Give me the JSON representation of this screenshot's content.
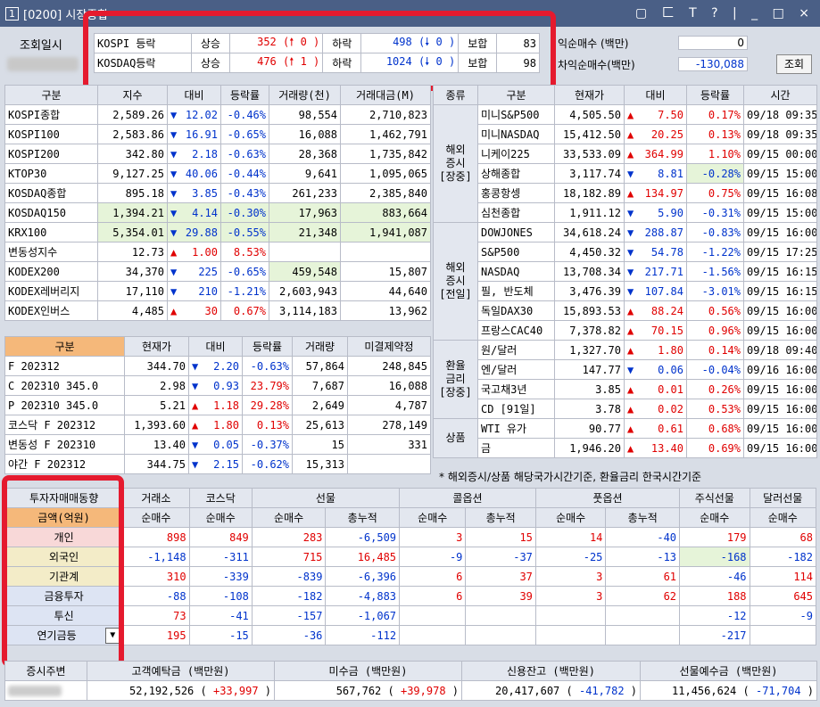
{
  "window": {
    "number": "1",
    "title": "[0200] 시장종합",
    "controls": "▢ 匚 T ? | _ □ ×"
  },
  "top": {
    "date_label": "조회일시",
    "kospi": {
      "label": "KOSPI 등락",
      "up_label": "상승",
      "up": "352 (🠕",
      "up_limit": "0 )",
      "down_label": "하락",
      "down": "498 (🠗",
      "down_limit": "0 )",
      "flat_label": "보합",
      "flat": "83"
    },
    "kosdaq": {
      "label": "KOSDAQ등락",
      "up_label": "상승",
      "up": "476 (🠕",
      "up_limit": "1 )",
      "down_label": "하락",
      "down": "1024 (🠗",
      "down_limit": "0 )",
      "flat_label": "보합",
      "flat": "98"
    },
    "arb_label": "익순매수 (백만)",
    "arb_value": "0",
    "nonarb_label": "차익순매수(백만)",
    "nonarb_value": "-130,088",
    "query_button": "조회"
  },
  "index_table": {
    "headers": [
      "구분",
      "지수",
      "대비",
      "등락률",
      "거래량(천)",
      "거래대금(M)"
    ],
    "rows": [
      [
        "KOSPI종합",
        "2,589.26",
        "▼",
        "12.02",
        "-0.46%",
        "98,554",
        "2,710,823"
      ],
      [
        "KOSPI100",
        "2,583.86",
        "▼",
        "16.91",
        "-0.65%",
        "16,088",
        "1,462,791"
      ],
      [
        "KOSPI200",
        "342.80",
        "▼",
        "2.18",
        "-0.63%",
        "28,368",
        "1,735,842"
      ],
      [
        "KTOP30",
        "9,127.25",
        "▼",
        "40.06",
        "-0.44%",
        "9,641",
        "1,095,065"
      ],
      [
        "KOSDAQ종합",
        "895.18",
        "▼",
        "3.85",
        "-0.43%",
        "261,233",
        "2,385,840"
      ],
      [
        "KOSDAQ150",
        "1,394.21",
        "▼",
        "4.14",
        "-0.30%",
        "17,963",
        "883,664"
      ],
      [
        "KRX100",
        "5,354.01",
        "▼",
        "29.88",
        "-0.55%",
        "21,348",
        "1,941,087"
      ],
      [
        "변동성지수",
        "12.73",
        "▲",
        "1.00",
        "8.53%",
        "",
        ""
      ],
      [
        "KODEX200",
        "34,370",
        "▼",
        "225",
        "-0.65%",
        "459,548",
        "15,807"
      ],
      [
        "KODEX레버리지",
        "17,110",
        "▼",
        "210",
        "-1.21%",
        "2,603,943",
        "44,640"
      ],
      [
        "KODEX인버스",
        "4,485",
        "▲",
        "30",
        "0.67%",
        "3,114,183",
        "13,962"
      ]
    ]
  },
  "futures_table": {
    "headers": [
      "구분",
      "현재가",
      "대비",
      "등락률",
      "거래량",
      "미결제약정"
    ],
    "rows": [
      [
        "F 202312",
        "344.70",
        "▼",
        "2.20",
        "-0.63%",
        "57,864",
        "248,845"
      ],
      [
        "C 202310 345.0",
        "2.98",
        "▼",
        "0.93",
        "23.79%",
        "7,687",
        "16,088"
      ],
      [
        "P 202310 345.0",
        "5.21",
        "▲",
        "1.18",
        "29.28%",
        "2,649",
        "4,787"
      ],
      [
        "코스닥 F 202312",
        "1,393.60",
        "▲",
        "1.80",
        "0.13%",
        "25,613",
        "278,149"
      ],
      [
        "변동성 F 202310",
        "13.40",
        "▼",
        "0.05",
        "-0.37%",
        "15",
        "331"
      ],
      [
        "야간 F 202312",
        "344.75",
        "▼",
        "2.15",
        "-0.62%",
        "15,313",
        ""
      ]
    ]
  },
  "world_table": {
    "headers": [
      "종류",
      "구분",
      "현재가",
      "대비",
      "등락률",
      "시간"
    ],
    "groups": [
      {
        "label": "해외\n증시\n[장중]",
        "rows": [
          [
            "미니S&P500",
            "4,505.50",
            "▲",
            "7.50",
            "0.17%",
            "09/18 09:35"
          ],
          [
            "미니NASDAQ",
            "15,412.50",
            "▲",
            "20.25",
            "0.13%",
            "09/18 09:35"
          ],
          [
            "니케이225",
            "33,533.09",
            "▲",
            "364.99",
            "1.10%",
            "09/15 00:00"
          ],
          [
            "상해종합",
            "3,117.74",
            "▼",
            "8.81",
            "-0.28%",
            "09/15 15:00"
          ],
          [
            "홍콩항셍",
            "18,182.89",
            "▲",
            "134.97",
            "0.75%",
            "09/15 16:08"
          ],
          [
            "심천종합",
            "1,911.12",
            "▼",
            "5.90",
            "-0.31%",
            "09/15 15:00"
          ]
        ]
      },
      {
        "label": "해외\n증시\n[전일]",
        "rows": [
          [
            "DOWJONES",
            "34,618.24",
            "▼",
            "288.87",
            "-0.83%",
            "09/15 16:00"
          ],
          [
            "S&P500",
            "4,450.32",
            "▼",
            "54.78",
            "-1.22%",
            "09/15 17:25"
          ],
          [
            "NASDAQ",
            "13,708.34",
            "▼",
            "217.71",
            "-1.56%",
            "09/15 16:15"
          ],
          [
            "필, 반도체",
            "3,476.39",
            "▼",
            "107.84",
            "-3.01%",
            "09/15 16:15"
          ],
          [
            "독일DAX30",
            "15,893.53",
            "▲",
            "88.24",
            "0.56%",
            "09/15 16:00"
          ],
          [
            "프랑스CAC40",
            "7,378.82",
            "▲",
            "70.15",
            "0.96%",
            "09/15 16:00"
          ]
        ]
      },
      {
        "label": "환율\n금리\n[장중]",
        "rows": [
          [
            "원/달러",
            "1,327.70",
            "▲",
            "1.80",
            "0.14%",
            "09/18 09:40"
          ],
          [
            "엔/달러",
            "147.77",
            "▼",
            "0.06",
            "-0.04%",
            "09/16 16:00"
          ],
          [
            "국고채3년",
            "3.85",
            "▲",
            "0.01",
            "0.26%",
            "09/15 16:00"
          ],
          [
            "CD [91일]",
            "3.78",
            "▲",
            "0.02",
            "0.53%",
            "09/15 16:00"
          ]
        ]
      },
      {
        "label": "상품",
        "rows": [
          [
            "WTI 유가",
            "90.77",
            "▲",
            "0.61",
            "0.68%",
            "09/15 16:00"
          ],
          [
            "금",
            "1,946.20",
            "▲",
            "13.40",
            "0.69%",
            "09/15 16:00"
          ]
        ]
      }
    ],
    "note": "* 해외증시/상품 해당국가시간기준, 환율금리 한국시간기준"
  },
  "investor": {
    "title": "투자자매매동향",
    "unit": "금액(억원)",
    "groups": [
      "거래소",
      "코스닥",
      "선물",
      "콜옵션",
      "풋옵션",
      "주식선물",
      "달러선물"
    ],
    "sub": [
      "순매수",
      "순매수",
      "순매수",
      "총누적",
      "순매수",
      "총누적",
      "순매수",
      "총누적",
      "순매수",
      "순매수"
    ],
    "rows": [
      {
        "name": "개인",
        "vals": [
          "898",
          "849",
          "283",
          "-6,509",
          "3",
          "15",
          "14",
          "-40",
          "179",
          "68"
        ]
      },
      {
        "name": "외국인",
        "vals": [
          "-1,148",
          "-311",
          "715",
          "16,485",
          "-9",
          "-37",
          "-25",
          "-13",
          "-168",
          "-182"
        ]
      },
      {
        "name": "기관계",
        "vals": [
          "310",
          "-339",
          "-839",
          "-6,396",
          "6",
          "37",
          "3",
          "61",
          "-46",
          "114"
        ]
      },
      {
        "name": "금융투자",
        "vals": [
          "-88",
          "-108",
          "-182",
          "-4,883",
          "6",
          "39",
          "3",
          "62",
          "188",
          "645"
        ]
      },
      {
        "name": "투신",
        "vals": [
          "73",
          "-41",
          "-157",
          "-1,067",
          "",
          "",
          "",
          "",
          "-12",
          "-9"
        ]
      },
      {
        "name": "연기금등",
        "vals": [
          "195",
          "-15",
          "-36",
          "-112",
          "",
          "",
          "",
          "",
          "-217",
          ""
        ]
      }
    ]
  },
  "bottom": {
    "label": "증시주변",
    "h1": "고객예탁금 (백만원)",
    "h2": "미수금 (백만원)",
    "h3": "신용잔고 (백만원)",
    "h4": "선물예수금 (백만원)",
    "v1": "52,192,526",
    "d1": "+33,997",
    "v2": "567,762",
    "d2": "+39,978",
    "v3": "20,417,607",
    "d3": "-41,782",
    "v4": "11,456,624",
    "d4": "-71,704"
  }
}
